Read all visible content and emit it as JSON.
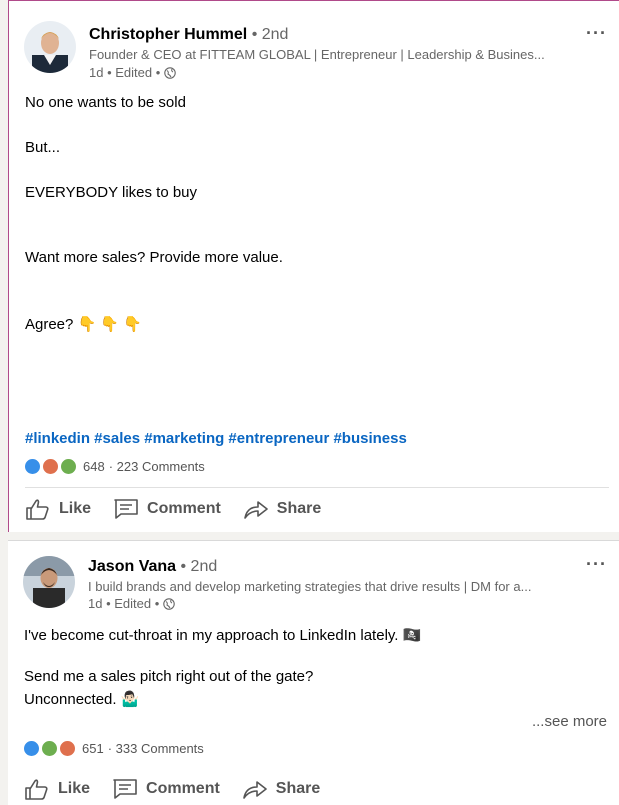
{
  "posts": [
    {
      "author": "Christopher Hummel",
      "degree": " • 2nd",
      "headline": "Founder & CEO at FITTEAM GLOBAL | Entrepreneur | Leadership & Busines...",
      "time": "1d • Edited •",
      "lines": [
        "No one wants to be sold",
        "But...",
        "EVERYBODY likes to buy",
        "Want more sales? Provide more value.",
        "Agree? 👇 👇 👇"
      ],
      "hashtags": "#linkedin #sales #marketing #entrepreneur #business",
      "reactions": [
        "like-icon",
        "love-icon",
        "celebrate-icon"
      ],
      "reaction_count": "648",
      "comments": "· 223 Comments"
    },
    {
      "author": "Jason Vana",
      "degree": " • 2nd",
      "headline": "I build brands and develop marketing strategies that drive results | DM for a...",
      "time": "1d • Edited •",
      "lines": [
        "I've become cut-throat in my approach to LinkedIn lately. 🏴‍☠️",
        "Send me a sales pitch right out of the gate?",
        "Unconnected. 🤷🏻‍♂️"
      ],
      "see_more": "...see more",
      "reactions": [
        "like-icon",
        "celebrate-icon",
        "love-icon"
      ],
      "reaction_count": "651",
      "comments": "· 333 Comments"
    }
  ],
  "actions": {
    "like": "Like",
    "comment": "Comment",
    "share": "Share"
  },
  "more_menu": "···"
}
